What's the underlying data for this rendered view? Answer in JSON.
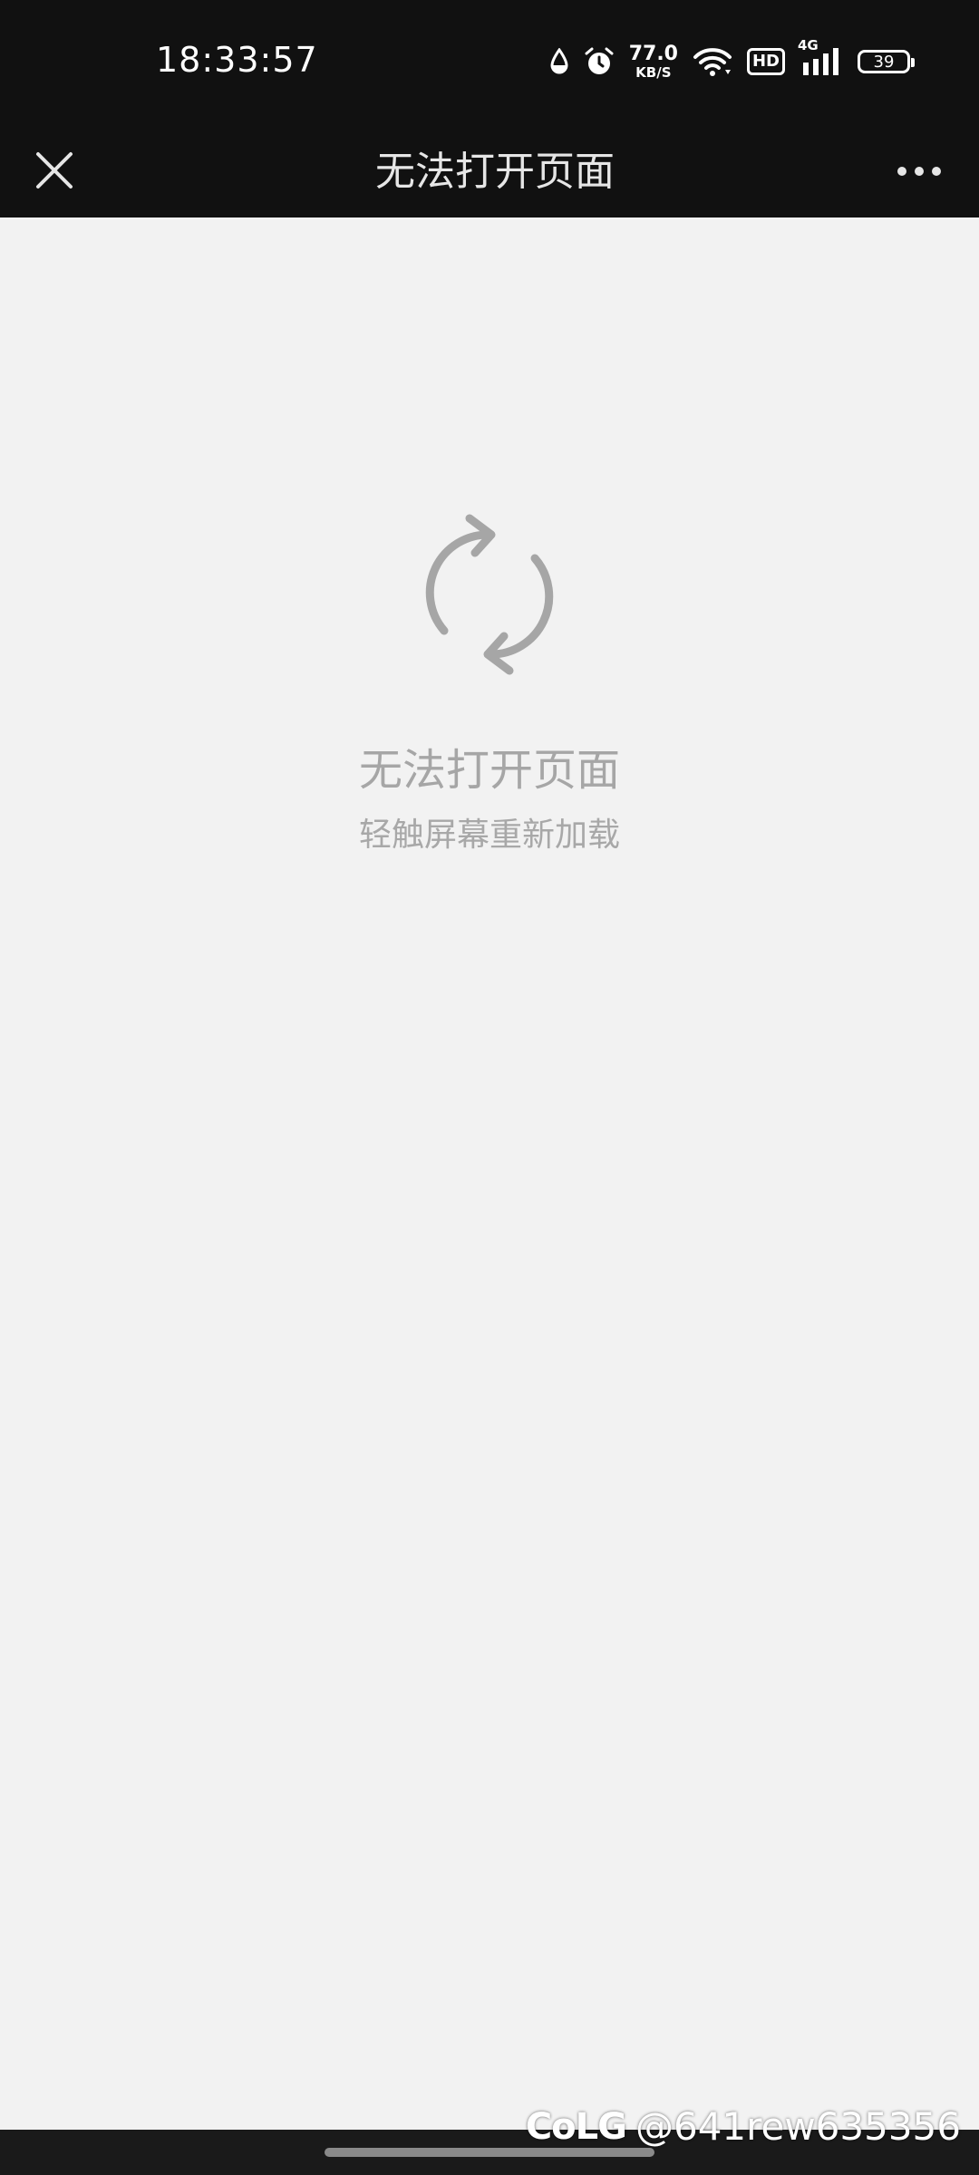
{
  "status_bar": {
    "time": "18:33:57",
    "net_speed_value": "77.0",
    "net_speed_unit": "KB/S",
    "hd_label": "HD",
    "network_type": "4G",
    "battery_level": "39",
    "icons": [
      "drop-icon",
      "alarm-icon",
      "wifi-icon",
      "hd-icon",
      "signal-icon",
      "battery-icon"
    ]
  },
  "title_bar": {
    "title": "无法打开页面",
    "close_icon": "close-icon",
    "more_icon": "more-icon"
  },
  "content": {
    "reload_icon": "reload-icon",
    "error_title": "无法打开页面",
    "error_hint": "轻触屏幕重新加载"
  },
  "watermark": {
    "logo": "CoLG",
    "handle": "@641rew635356"
  },
  "colors": {
    "bar_background": "#111111",
    "page_background": "#f2f2f2",
    "muted_text": "#a6a6a6"
  }
}
